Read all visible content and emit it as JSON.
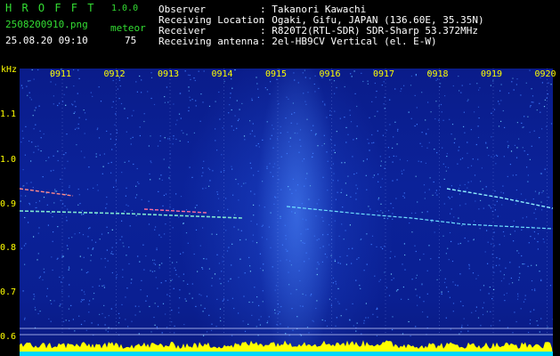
{
  "app": {
    "logo": "H R O F F T",
    "version": "1.0.0"
  },
  "file": {
    "name": "2508200910.png",
    "timestamp": "25.08.20 09:10"
  },
  "counter": {
    "label": "meteor",
    "value": "75"
  },
  "info": [
    {
      "label": "Observer",
      "value": ": Takanori Kawachi"
    },
    {
      "label": "Receiving Location",
      "value": ": Ogaki, Gifu, JAPAN (136.60E, 35.35N)"
    },
    {
      "label": "Receiver",
      "value": ": R820T2(RTL-SDR) SDR-Sharp 53.372MHz"
    },
    {
      "label": "Receiving antenna",
      "value": ": 2el-HB9CV Vertical (el. E-W)"
    }
  ],
  "axis": {
    "unit": "kHz",
    "y_ticks": [
      "1.1",
      "1.0",
      "0.9",
      "0.8",
      "0.7",
      "0.6"
    ],
    "x_ticks": [
      "0911",
      "0912",
      "0913",
      "0914",
      "0915",
      "0916",
      "0917",
      "0918",
      "0919",
      "0920"
    ]
  },
  "colors": {
    "background": "#0a1f92",
    "trace": "#ffff00",
    "accent": "#33dd33"
  }
}
